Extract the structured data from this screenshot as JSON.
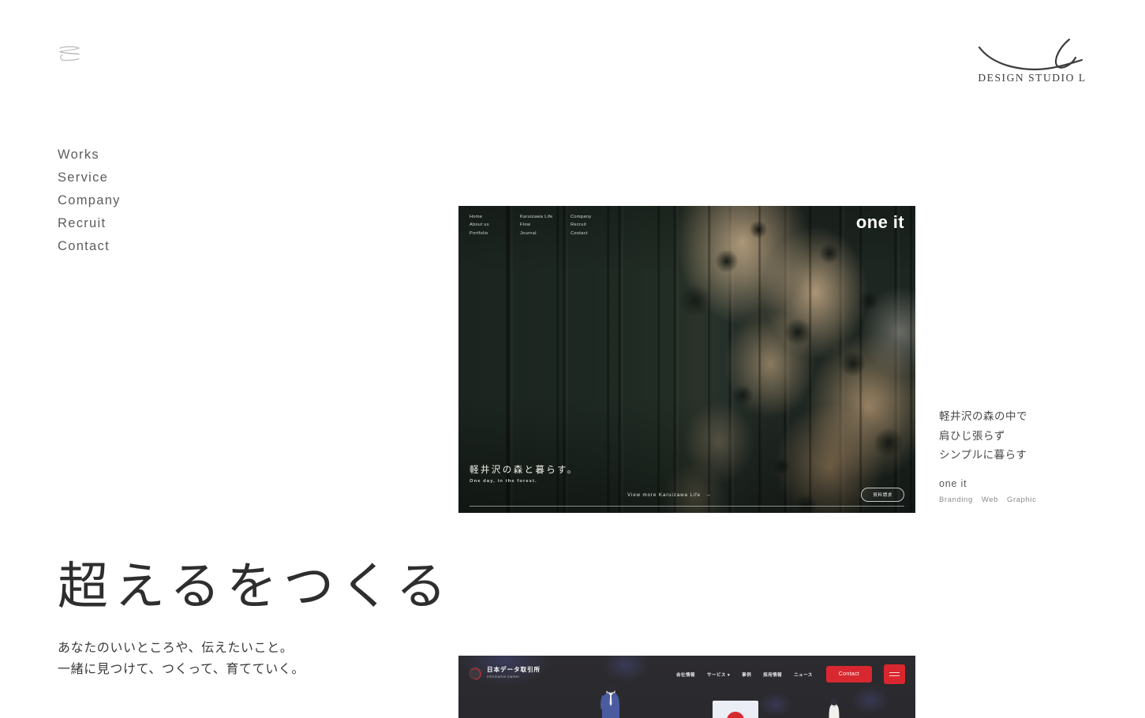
{
  "site": {
    "brand_name": "DESIGN STUDIO L",
    "menu_icon": "hamburger-icon",
    "logo_icon": "cursive-l-swoosh-icon"
  },
  "nav": {
    "items": [
      {
        "label": "Works"
      },
      {
        "label": "Service"
      },
      {
        "label": "Company"
      },
      {
        "label": "Recruit"
      },
      {
        "label": "Contact"
      }
    ]
  },
  "work_hero": {
    "brand": "one it",
    "site_nav": [
      {
        "items": [
          "Home",
          "About us",
          "Portfolio"
        ]
      },
      {
        "items": [
          "Karuizawa Life",
          "Flow",
          "Journal"
        ]
      },
      {
        "items": [
          "Company",
          "Recruit",
          "Contact"
        ]
      }
    ],
    "headline_jp": "軽井沢の森と暮らす。",
    "headline_en": "One day, in the forest.",
    "view_more": "View more Karuizawa Life",
    "view_more_arrow": "→",
    "pill_button": "資料請求"
  },
  "work_caption": {
    "lines": [
      "軽井沢の森の中で",
      "肩ひじ張らず",
      "シンプルに暮らす"
    ],
    "client": "one it",
    "tags": [
      "Branding",
      "Web",
      "Graphic"
    ]
  },
  "headline_block": {
    "title": "超えるをつくる",
    "sub_line_1": "あなたのいいところや、伝えたいこと。",
    "sub_line_2": "一緒に見つけて、つくって、育てていく。"
  },
  "work_two": {
    "brand_title": "日本データ取引所",
    "brand_tagline": "information market",
    "nav": [
      {
        "label": "会社情報"
      },
      {
        "label": "サービス ▾"
      },
      {
        "label": "事例"
      },
      {
        "label": "採用情報"
      },
      {
        "label": "ニュース"
      }
    ],
    "contact_label": "Contact",
    "menu_icon": "hamburger-icon",
    "accent_color": "#d8272e"
  },
  "colors": {
    "page_background": "#ffffff",
    "text_primary": "#2e2e2e",
    "text_muted": "#5d5d5d",
    "hero_background": "#1d2720"
  }
}
